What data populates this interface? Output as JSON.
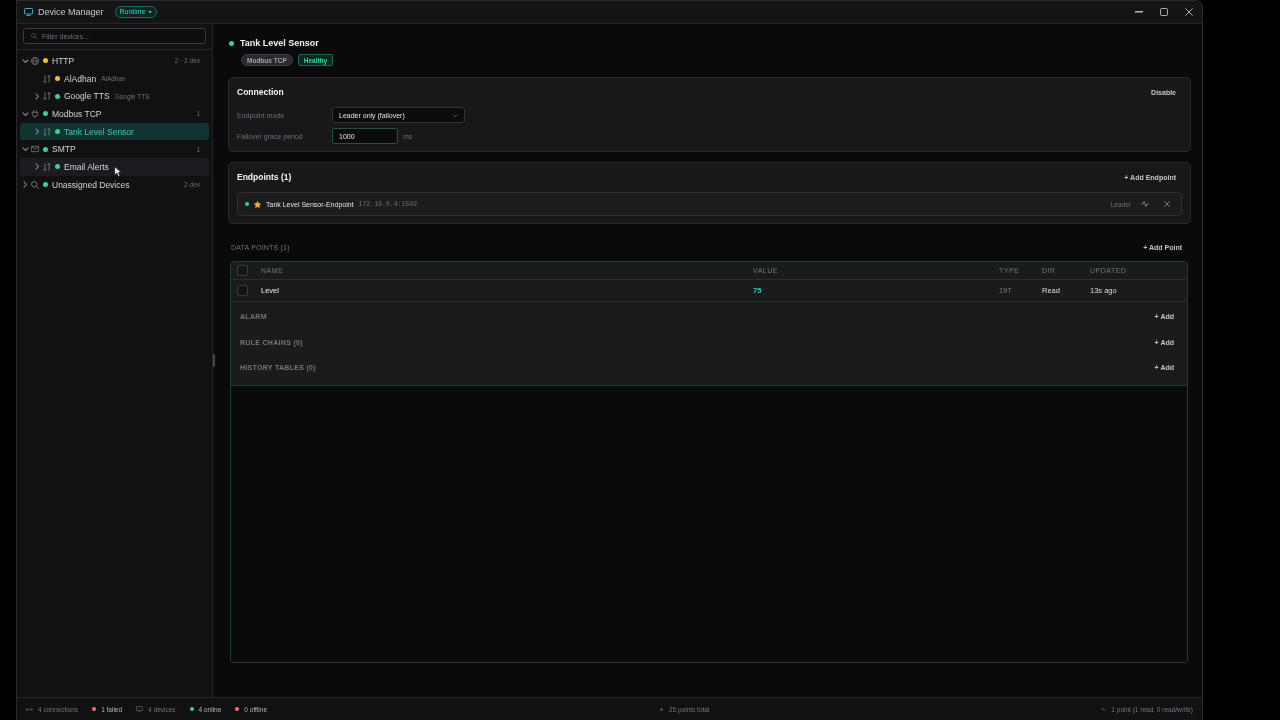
{
  "window": {
    "title": "Device Manager",
    "mode": "Runtime"
  },
  "sidebar": {
    "search": {
      "placeholder": "Filter devices..."
    },
    "tree": [
      {
        "kind": "http",
        "label": "HTTP",
        "color": "#fbbf24",
        "count": "2 · 2 dev",
        "expandable": true,
        "expanded": true,
        "selected": false,
        "hovered": false,
        "children": [
          {
            "kind": "device",
            "label": "AlAdhan",
            "subtitle": "AlAdhan",
            "color": "#fbbf24",
            "expandable": false,
            "selected": false,
            "hovered": false
          },
          {
            "kind": "device",
            "label": "Google TTS",
            "subtitle": "Google TTS",
            "color": "#34d399",
            "expandable": true,
            "expanded": false,
            "selected": false,
            "hovered": false
          }
        ]
      },
      {
        "kind": "modbus",
        "label": "Modbus TCP",
        "color": "#34d399",
        "count": "1",
        "expandable": true,
        "expanded": true,
        "selected": false,
        "hovered": false,
        "children": [
          {
            "kind": "device",
            "label": "Tank Level Sensor",
            "color": "#34d399",
            "expandable": true,
            "expanded": false,
            "selected": true,
            "hovered": false
          }
        ]
      },
      {
        "kind": "smtp",
        "label": "SMTP",
        "color": "#34d399",
        "count": "1",
        "expandable": true,
        "expanded": true,
        "selected": false,
        "hovered": false,
        "children": [
          {
            "kind": "device",
            "label": "Email Alerts",
            "color": "#34d399",
            "expandable": true,
            "expanded": false,
            "selected": false,
            "hovered": true
          }
        ]
      },
      {
        "kind": "unassigned",
        "label": "Unassigned Devices",
        "color": "#34d399",
        "count": "2 dev",
        "expandable": true,
        "expanded": false,
        "selected": false,
        "hovered": false
      }
    ]
  },
  "device": {
    "name": "Tank Level Sensor",
    "color": "#34d399",
    "tags": [
      {
        "kind": "protocol",
        "label": "Modbus TCP"
      },
      {
        "kind": "health",
        "label": "Healthy"
      }
    ]
  },
  "connection": {
    "title": "Connection",
    "action": "Disable",
    "fields": [
      {
        "kind": "select",
        "label": "Endpoint mode",
        "value": "Leader only (failover)",
        "focused": false
      },
      {
        "kind": "number",
        "label": "Failover grace period",
        "value": "1000",
        "unit": "ms",
        "focused": true
      }
    ]
  },
  "endpoints": {
    "title": "Endpoints (1)",
    "action": "+ Add Endpoint",
    "items": [
      {
        "name": "Tank Level Sensor-Endpoint",
        "address": "172.19.0.4:1502",
        "role": "Leader",
        "starred": true,
        "color": "#34d399"
      }
    ]
  },
  "data_points": {
    "title": "DATA POINTS (1)",
    "action": "+ Add Point",
    "all_checked": false,
    "columns": [
      "NAME",
      "VALUE",
      "TYPE",
      "DIR",
      "UPDATED"
    ],
    "rows": [
      {
        "name": "Level",
        "value": "75",
        "type": "INT",
        "dir": "Read",
        "updated": "13s ago",
        "checked": false
      }
    ],
    "sections": [
      {
        "title": "ALARM",
        "action": "+ Add"
      },
      {
        "title": "RULE CHAINS (0)",
        "action": "+ Add"
      },
      {
        "title": "HISTORY TABLES (0)",
        "action": "+ Add"
      }
    ]
  },
  "status_bar": {
    "items": [
      {
        "kind": "connections",
        "text": "4 connections"
      },
      {
        "kind": "status",
        "text": "1 failed",
        "color": "#f87171"
      },
      {
        "kind": "devices",
        "text": "4 devices"
      },
      {
        "kind": "status",
        "text": "4 online",
        "color": "#34d399"
      },
      {
        "kind": "status",
        "text": "0 offline",
        "color": "#f87171"
      }
    ],
    "summary": "25 points total",
    "detail": "1 point (1 read, 0 read/write)"
  }
}
